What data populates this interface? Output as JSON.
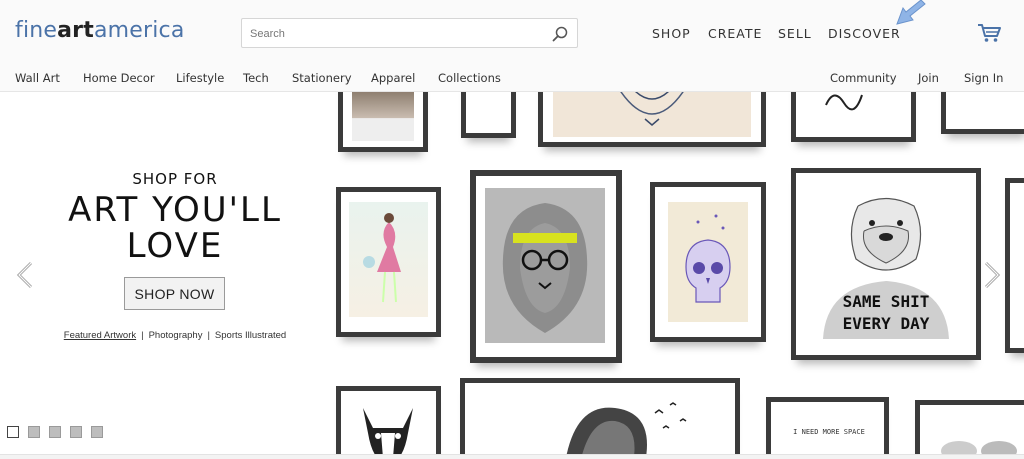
{
  "logo": {
    "part1": "fine",
    "part2": "art",
    "part3": "america"
  },
  "search": {
    "placeholder": "Search",
    "value": ""
  },
  "top_nav": [
    "SHOP",
    "CREATE",
    "SELL",
    "DISCOVER"
  ],
  "sub_nav_left": [
    "Wall Art",
    "Home Decor",
    "Lifestyle",
    "Tech",
    "Stationery",
    "Apparel",
    "Collections"
  ],
  "sub_nav_right": [
    "Community",
    "Join",
    "Sign In"
  ],
  "hero": {
    "line1": "SHOP FOR",
    "line2": "ART YOU'LL",
    "line3": "LOVE",
    "button": "SHOP NOW",
    "links": [
      "Featured Artwork",
      "Photography",
      "Sports Illustrated"
    ],
    "link_separator": "|",
    "slide_count": 5,
    "active_slide": 1
  },
  "artwork_text": {
    "shirt_line1": "SAME SHIT",
    "shirt_line2": "EVERY DAY",
    "poster_text": "I NEED MORE SPACE"
  },
  "colors": {
    "logo_blue": "#4b73a8",
    "frame": "#3b3b3b",
    "headband": "#d8e21f",
    "cursor": "#8fb4e6"
  },
  "icons": [
    "search-icon",
    "cart-icon",
    "cursor-arrow-icon",
    "chevron-left-icon",
    "chevron-right-icon"
  ]
}
